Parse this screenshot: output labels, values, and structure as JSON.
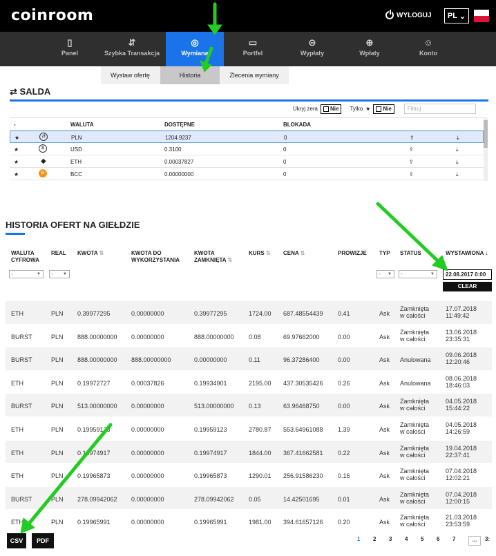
{
  "header": {
    "logo": "coinroom",
    "logout_label": "WYLOGUJ",
    "lang_label": "PL"
  },
  "nav": [
    {
      "label": "Panel",
      "icon": "tablet-icon"
    },
    {
      "label": "Szybka Transakcja",
      "icon": "transaction-icon"
    },
    {
      "label": "Wymiana",
      "icon": "exchange-icon"
    },
    {
      "label": "Portfel",
      "icon": "wallet-icon"
    },
    {
      "label": "Wypłaty",
      "icon": "withdraw-icon"
    },
    {
      "label": "Wpłaty",
      "icon": "deposit-icon"
    },
    {
      "label": "Konto",
      "icon": "account-icon"
    }
  ],
  "subnav": [
    "Wystaw ofertę",
    "Historia",
    "Zlecenia wymiany"
  ],
  "salda": {
    "title": "SALDA",
    "hide_zero_label": "Ukryj zera",
    "only_star_label": "Tylko",
    "toggle_no": "Nie",
    "filter_placeholder": "Filtruj",
    "headers": {
      "dash": "-",
      "currency": "WALUTA",
      "available": "DOSTĘPNE",
      "blocked": "BLOKADA"
    },
    "rows": [
      {
        "symbol": "zł",
        "currency": "PLN",
        "available": "1204.9237",
        "blocked": "0"
      },
      {
        "symbol": "$",
        "currency": "USD",
        "available": "0.3100",
        "blocked": "0"
      },
      {
        "symbol": "◆",
        "currency": "ETH",
        "available": "0.00037827",
        "blocked": "0"
      },
      {
        "symbol": "B",
        "currency": "BCC",
        "available": "0.00000000",
        "blocked": "0"
      }
    ]
  },
  "history": {
    "title": "HISTORIA OFERT NA GIEŁDZIE",
    "headers": {
      "crypto": "WALUTA\nCYFROWA",
      "real": "REAL",
      "amount": "KWOTA",
      "amount_to_use": "KWOTA DO\nWYKORZYSTANIA",
      "amount_closed": "KWOTA\nZAMKNIĘTA",
      "rate": "KURS",
      "price": "CENA",
      "fees": "PROWIZJE",
      "type": "TYP",
      "status": "STATUS",
      "issued": "WYSTAWIONA"
    },
    "select_dash": "-",
    "date_filter": "22.08.2017 0:00",
    "clear_label": "CLEAR",
    "rows": [
      {
        "crypto": "ETH",
        "real": "PLN",
        "amount": "0.39977295",
        "to_use": "0.00000000",
        "closed": "0.39977295",
        "rate": "1724.00",
        "price": "687.48554439",
        "fee": "0.41",
        "type": "Ask",
        "status": "Zamknięta\nw całości",
        "date": "17.07.2018\n11:49:42"
      },
      {
        "crypto": "BURST",
        "real": "PLN",
        "amount": "888.00000000",
        "to_use": "0.00000000",
        "closed": "888.00000000",
        "rate": "0.08",
        "price": "69.97662000",
        "fee": "0.00",
        "type": "Ask",
        "status": "Zamknięta\nw całości",
        "date": "13.06.2018\n23:35:31"
      },
      {
        "crypto": "BURST",
        "real": "PLN",
        "amount": "888.00000000",
        "to_use": "888.00000000",
        "closed": "0.00000000",
        "rate": "0.11",
        "price": "96.37286400",
        "fee": "0.00",
        "type": "Ask",
        "status": "Anulowana",
        "date": "09.06.2018\n12:20:46"
      },
      {
        "crypto": "ETH",
        "real": "PLN",
        "amount": "0.19972727",
        "to_use": "0.00037826",
        "closed": "0.19934901",
        "rate": "2195.00",
        "price": "437.30535426",
        "fee": "0.26",
        "type": "Ask",
        "status": "Anulowana",
        "date": "08.06.2018\n18:46:03"
      },
      {
        "crypto": "BURST",
        "real": "PLN",
        "amount": "513.00000000",
        "to_use": "0.00000000",
        "closed": "513.00000000",
        "rate": "0.13",
        "price": "63.96468750",
        "fee": "0.00",
        "type": "Ask",
        "status": "Zamknięta\nw całości",
        "date": "04.05.2018\n15:44:22"
      },
      {
        "crypto": "ETH",
        "real": "PLN",
        "amount": "0.19959123",
        "to_use": "0.00000000",
        "closed": "0.19959123",
        "rate": "2780.87",
        "price": "553.64961088",
        "fee": "1.39",
        "type": "Ask",
        "status": "Zamknięta\nw całości",
        "date": "04.05.2018\n14:26:59"
      },
      {
        "crypto": "ETH",
        "real": "PLN",
        "amount": "0.19974917",
        "to_use": "0.00000000",
        "closed": "0.19974917",
        "rate": "1844.00",
        "price": "367.41662581",
        "fee": "0.22",
        "type": "Ask",
        "status": "Zamknięta\nw całości",
        "date": "19.04.2018\n22:37:41"
      },
      {
        "crypto": "ETH",
        "real": "PLN",
        "amount": "0.19965873",
        "to_use": "0.00000000",
        "closed": "0.19965873",
        "rate": "1290.01",
        "price": "256.91586230",
        "fee": "0.16",
        "type": "Ask",
        "status": "Zamknięta\nw całości",
        "date": "07.04.2018\n12:02:21"
      },
      {
        "crypto": "BURST",
        "real": "PLN",
        "amount": "278.09942062",
        "to_use": "0.00000000",
        "closed": "278.09942062",
        "rate": "0.05",
        "price": "14.42501695",
        "fee": "0.01",
        "type": "Ask",
        "status": "Zamknięta\nw całości",
        "date": "07.04.2018\n12:00:15"
      },
      {
        "crypto": "ETH",
        "real": "PLN",
        "amount": "0.19965991",
        "to_use": "0.00000000",
        "closed": "0.19965991",
        "rate": "1981.00",
        "price": "394.61657126",
        "fee": "0.20",
        "type": "Ask",
        "status": "Zamknięta\nw całości",
        "date": "21.03.2018\n23:53:59"
      }
    ]
  },
  "footer": {
    "csv_label": "CSV",
    "pdf_label": "PDF",
    "pages": [
      "1",
      "2",
      "3",
      "4",
      "5",
      "6",
      "7",
      "...",
      "3:"
    ]
  },
  "colors": {
    "accent": "#1a73e8",
    "arrow": "#22cc22",
    "nav_bg": "#2f2f2f",
    "top_bg": "#000000"
  }
}
